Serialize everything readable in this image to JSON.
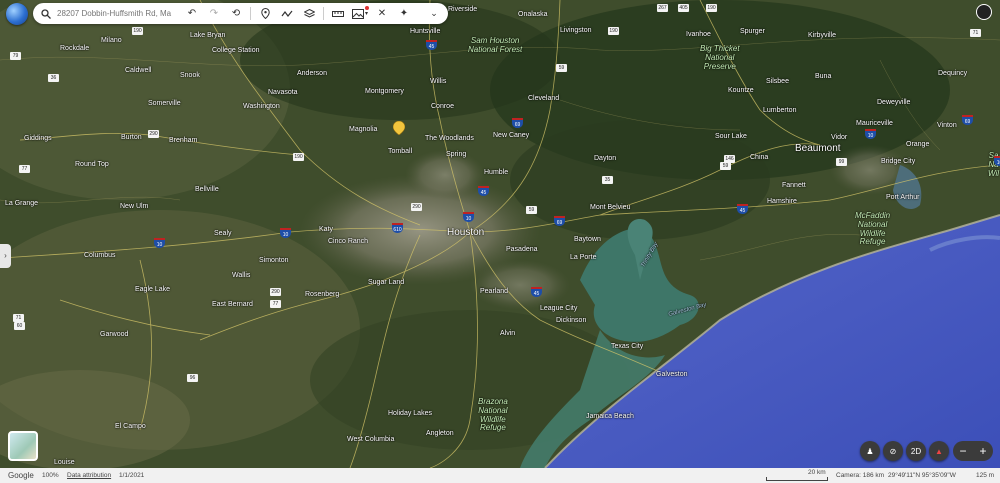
{
  "search": {
    "placeholder": "28207 Dobbin-Huffsmith Rd, Ma"
  },
  "toolbar": {
    "icons": [
      "undo-icon",
      "redo-icon",
      "history-icon",
      "pin-icon",
      "path-icon",
      "layers-icon",
      "ruler-icon",
      "image-icon",
      "tools-icon",
      "sparkle-icon",
      "chevron-down-icon"
    ]
  },
  "map": {
    "cities": [
      {
        "name": "Houston",
        "big": true
      },
      {
        "name": "Beaumont",
        "big": true
      },
      {
        "name": "Huntsville"
      },
      {
        "name": "Riverside"
      },
      {
        "name": "Onalaska"
      },
      {
        "name": "Livingston"
      },
      {
        "name": "Ivanhoe"
      },
      {
        "name": "Spurger"
      },
      {
        "name": "Kirbyville"
      },
      {
        "name": "Rockdale"
      },
      {
        "name": "Milano"
      },
      {
        "name": "Lake Bryan"
      },
      {
        "name": "College Station"
      },
      {
        "name": "Caldwell"
      },
      {
        "name": "Snook"
      },
      {
        "name": "Anderson"
      },
      {
        "name": "Navasota"
      },
      {
        "name": "Somerville"
      },
      {
        "name": "Washington"
      },
      {
        "name": "Montgomery"
      },
      {
        "name": "Willis"
      },
      {
        "name": "Conroe"
      },
      {
        "name": "Cleveland"
      },
      {
        "name": "Kountze"
      },
      {
        "name": "Silsbee"
      },
      {
        "name": "Buna"
      },
      {
        "name": "Deweyville"
      },
      {
        "name": "Dequincy"
      },
      {
        "name": "Lumberton"
      },
      {
        "name": "Mauriceville"
      },
      {
        "name": "Vinton"
      },
      {
        "name": "Giddings"
      },
      {
        "name": "Burton"
      },
      {
        "name": "Brenham"
      },
      {
        "name": "Magnolia"
      },
      {
        "name": "The Woodlands"
      },
      {
        "name": "Tomball"
      },
      {
        "name": "Spring"
      },
      {
        "name": "New Caney"
      },
      {
        "name": "Sour Lake"
      },
      {
        "name": "Vidor"
      },
      {
        "name": "Orange"
      },
      {
        "name": "Bridge City"
      },
      {
        "name": "Round Top"
      },
      {
        "name": "Dayton"
      },
      {
        "name": "China"
      },
      {
        "name": "Humble"
      },
      {
        "name": "La Grange"
      },
      {
        "name": "Bellville"
      },
      {
        "name": "Fannett"
      },
      {
        "name": "Port Arthur"
      },
      {
        "name": "New Ulm"
      },
      {
        "name": "Mont Belvieu"
      },
      {
        "name": "Hamshire"
      },
      {
        "name": "Katy"
      },
      {
        "name": "Cinco Ranch"
      },
      {
        "name": "Sealy"
      },
      {
        "name": "Baytown"
      },
      {
        "name": "Columbus"
      },
      {
        "name": "Simonton"
      },
      {
        "name": "Pasadena"
      },
      {
        "name": "La Porte"
      },
      {
        "name": "Wallis"
      },
      {
        "name": "Sugar Land"
      },
      {
        "name": "Eagle Lake"
      },
      {
        "name": "Rosenberg"
      },
      {
        "name": "Pearland"
      },
      {
        "name": "East Bernard"
      },
      {
        "name": "League City"
      },
      {
        "name": "Dickinson"
      },
      {
        "name": "Garwood"
      },
      {
        "name": "Alvin"
      },
      {
        "name": "Texas City"
      },
      {
        "name": "Galveston"
      },
      {
        "name": "El Campo"
      },
      {
        "name": "Holiday Lakes"
      },
      {
        "name": "Jamaica Beach"
      },
      {
        "name": "West Columbia"
      },
      {
        "name": "Angleton"
      },
      {
        "name": "Louise"
      }
    ],
    "parks": [
      {
        "name": "Sam Houston\nNational Forest"
      },
      {
        "name": "Big Thicket\nNational\nPreserve"
      },
      {
        "name": "McFaddin\nNational\nWildlife\nRefuge"
      },
      {
        "name": "Brazona\nNational\nWildlife\nRefuge"
      },
      {
        "name": "Sa\nNa\nWil"
      }
    ],
    "waters": [
      {
        "name": "Trinity Bay"
      },
      {
        "name": "Galveston Bay"
      }
    ],
    "interstate_shields": [
      "45",
      "69",
      "10",
      "10",
      "10",
      "610",
      "45",
      "45",
      "69",
      "45",
      "10",
      "69",
      "10"
    ],
    "highway_shields": [
      "267",
      "405",
      "190",
      "190",
      "79",
      "190",
      "36",
      "290",
      "190",
      "59",
      "146",
      "77",
      "290",
      "59",
      "290",
      "96",
      "77",
      "71",
      "60",
      "35",
      "59",
      "99",
      "71"
    ],
    "colors": {
      "land": "#3d4b2b",
      "gulf": "#4a5fc4",
      "bay": "#3e7668",
      "urban": "#8b8a78",
      "road": "#d8c86a"
    }
  },
  "controls": {
    "view_2d": "2D",
    "zoom_out": "−",
    "zoom_in": "+",
    "icons": [
      "street-view-icon",
      "no-tilt-icon",
      "compass-icon"
    ]
  },
  "status": {
    "provider": "Google",
    "zoom": "100%",
    "attribution": "Data attribution",
    "date": "1/1/2021",
    "scale": "20 km",
    "camera": "Camera: 186 km",
    "coords": "29°49'11\"N 95°35'09\"W",
    "elevation": "125 m"
  }
}
